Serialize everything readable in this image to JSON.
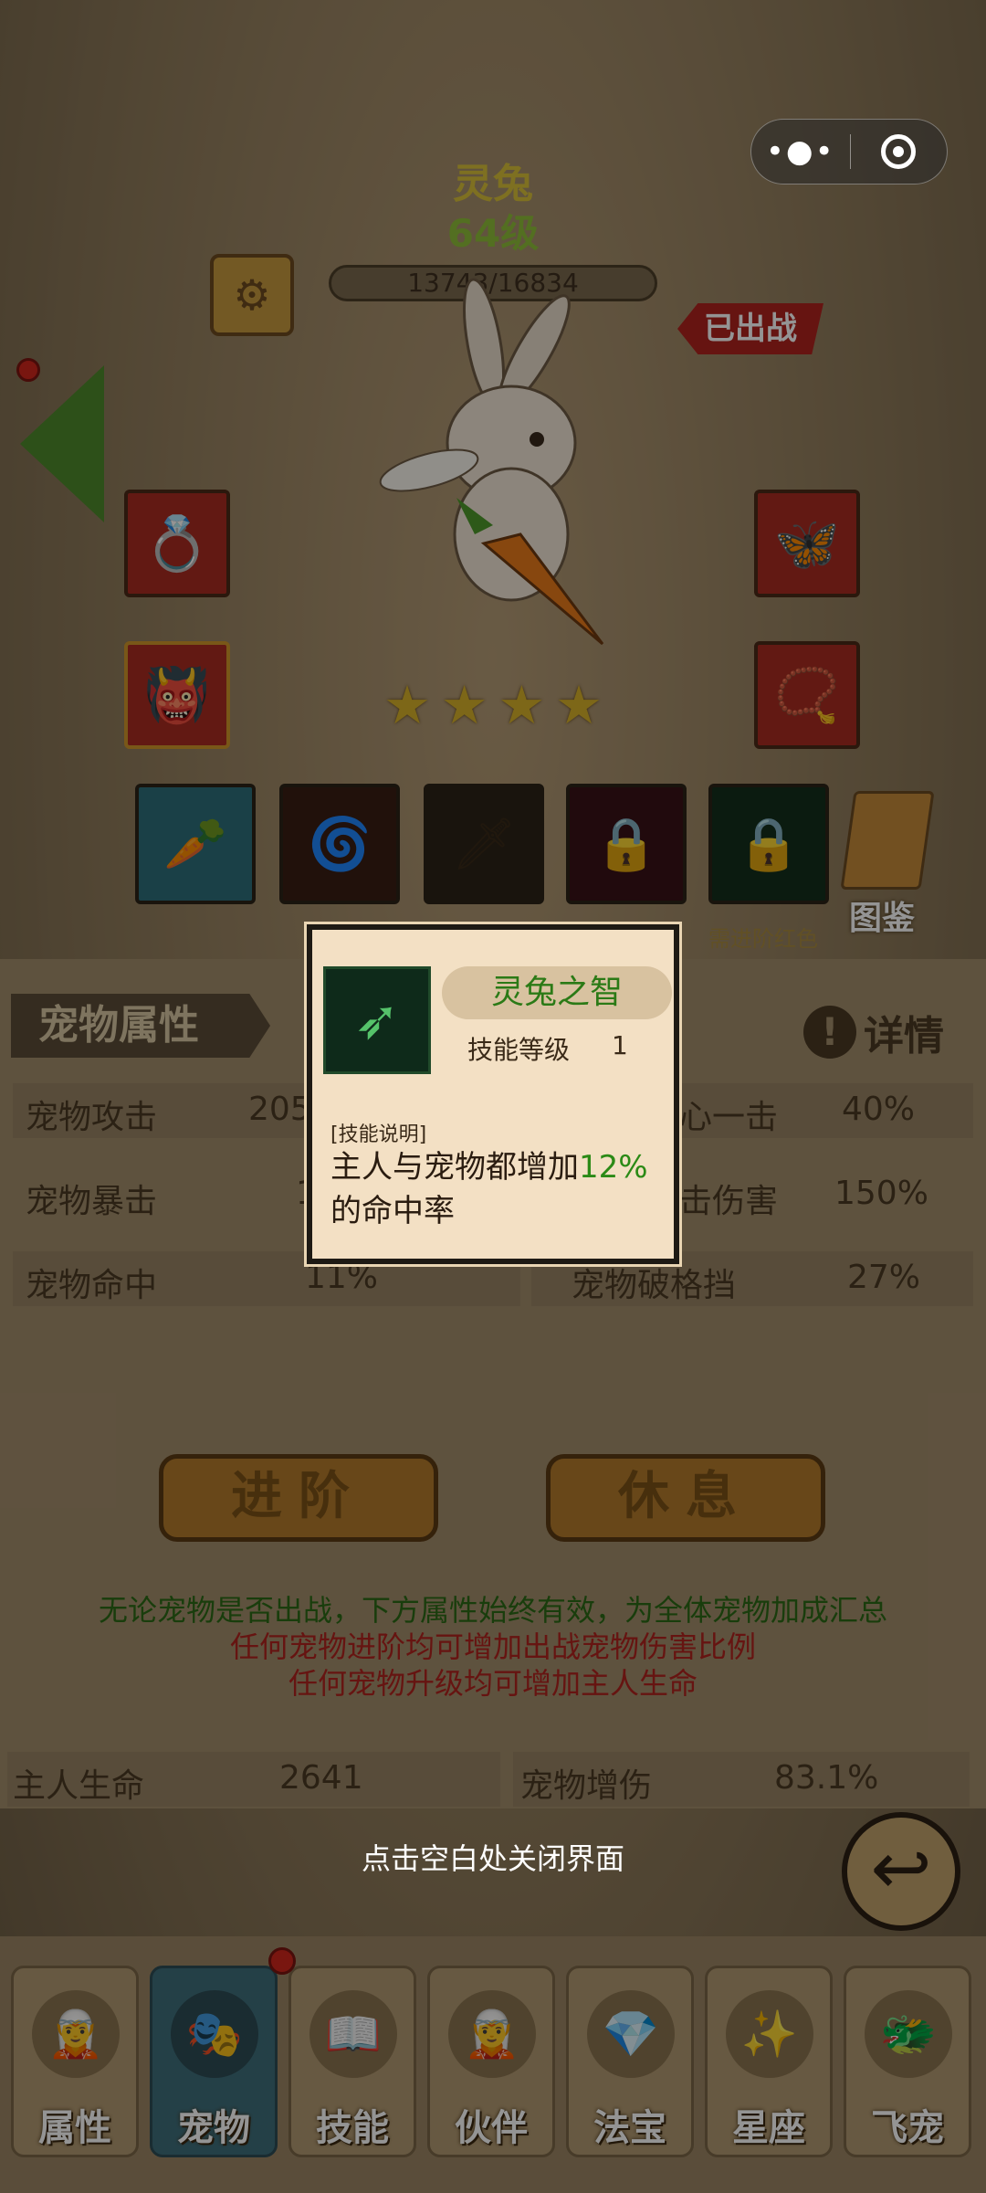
{
  "pet": {
    "name": "灵兔",
    "level": "64级",
    "exp_text": "13743/16834",
    "status": "已出战",
    "stars": 4
  },
  "skills": {
    "atlas_label": "图鉴",
    "need_red": "需进阶红色"
  },
  "attributes": {
    "title": "宠物属性",
    "detail": "详情",
    "rows": [
      {
        "label": "宠物攻击",
        "value": "205",
        "label2": "心一击",
        "value2": "40%"
      },
      {
        "label": "宠物暴击",
        "value": "1",
        "label2": "击伤害",
        "value2": "150%"
      },
      {
        "label": "宠物命中",
        "value": "11%",
        "label2": "宠物破格挡",
        "value2": "27%"
      }
    ]
  },
  "buttons": {
    "advance": "进阶",
    "rest": "休息"
  },
  "info": {
    "line1": "无论宠物是否出战，下方属性始终有效，为全体宠物加成汇总",
    "line2": "任何宠物进阶均可增加出战宠物伤害比例",
    "line3": "任何宠物升级均可增加主人生命"
  },
  "summary": {
    "owner_hp_label": "主人生命",
    "owner_hp_value": "2641",
    "pet_dmg_label": "宠物增伤",
    "pet_dmg_value": "83.1%"
  },
  "close_hint": "点击空白处关闭界面",
  "tabs": [
    {
      "label": "属性"
    },
    {
      "label": "宠物"
    },
    {
      "label": "技能"
    },
    {
      "label": "伙伴"
    },
    {
      "label": "法宝"
    },
    {
      "label": "星座"
    },
    {
      "label": "飞宠"
    }
  ],
  "popup": {
    "title": "灵兔之智",
    "level_label": "技能等级",
    "level_value": "1",
    "desc_head": "[技能说明]",
    "desc_before": "主人与宠物都增加",
    "desc_highlight": "12%",
    "desc_after": "的命中率"
  },
  "colors": {
    "accent_green": "#2b8a16",
    "accent_red": "#b0231e",
    "gold": "#d7b22a"
  }
}
